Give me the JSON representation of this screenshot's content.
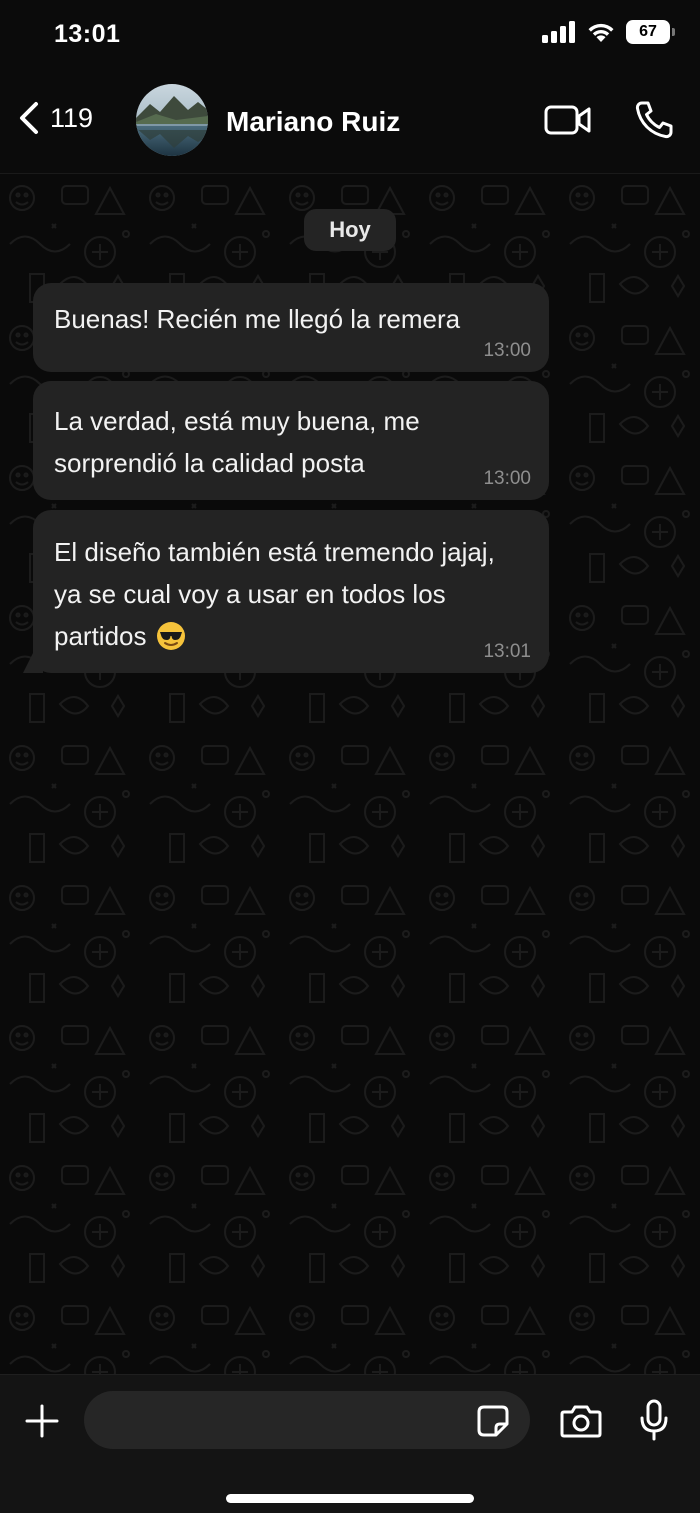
{
  "status_bar": {
    "time": "13:01",
    "battery": "67",
    "icons": [
      "signal-icon",
      "wifi-icon",
      "battery-icon"
    ]
  },
  "header": {
    "back_count": "119",
    "contact_name": "Mariano Ruiz",
    "icons": [
      "chevron-left-icon",
      "video-camera-icon",
      "phone-icon"
    ]
  },
  "chat": {
    "date_label": "Hoy",
    "messages": [
      {
        "text": "Buenas! Recién me llegó la remera",
        "time": "13:00"
      },
      {
        "text": "La verdad, está muy buena, me sorprendió la calidad posta",
        "time": "13:00"
      },
      {
        "text": "El diseño también está tremendo jajaj, ya se cual voy a usar en todos los partidos",
        "emoji": "smiling-face-with-sunglasses",
        "time": "13:01"
      }
    ]
  },
  "input_bar": {
    "message_value": "",
    "icons": [
      "plus-icon",
      "sticker-icon",
      "camera-icon",
      "microphone-icon"
    ]
  },
  "colors": {
    "background": "#000000",
    "bubble": "#232323",
    "timestamp": "#8e8e8e",
    "header": "#0b0b0b"
  }
}
